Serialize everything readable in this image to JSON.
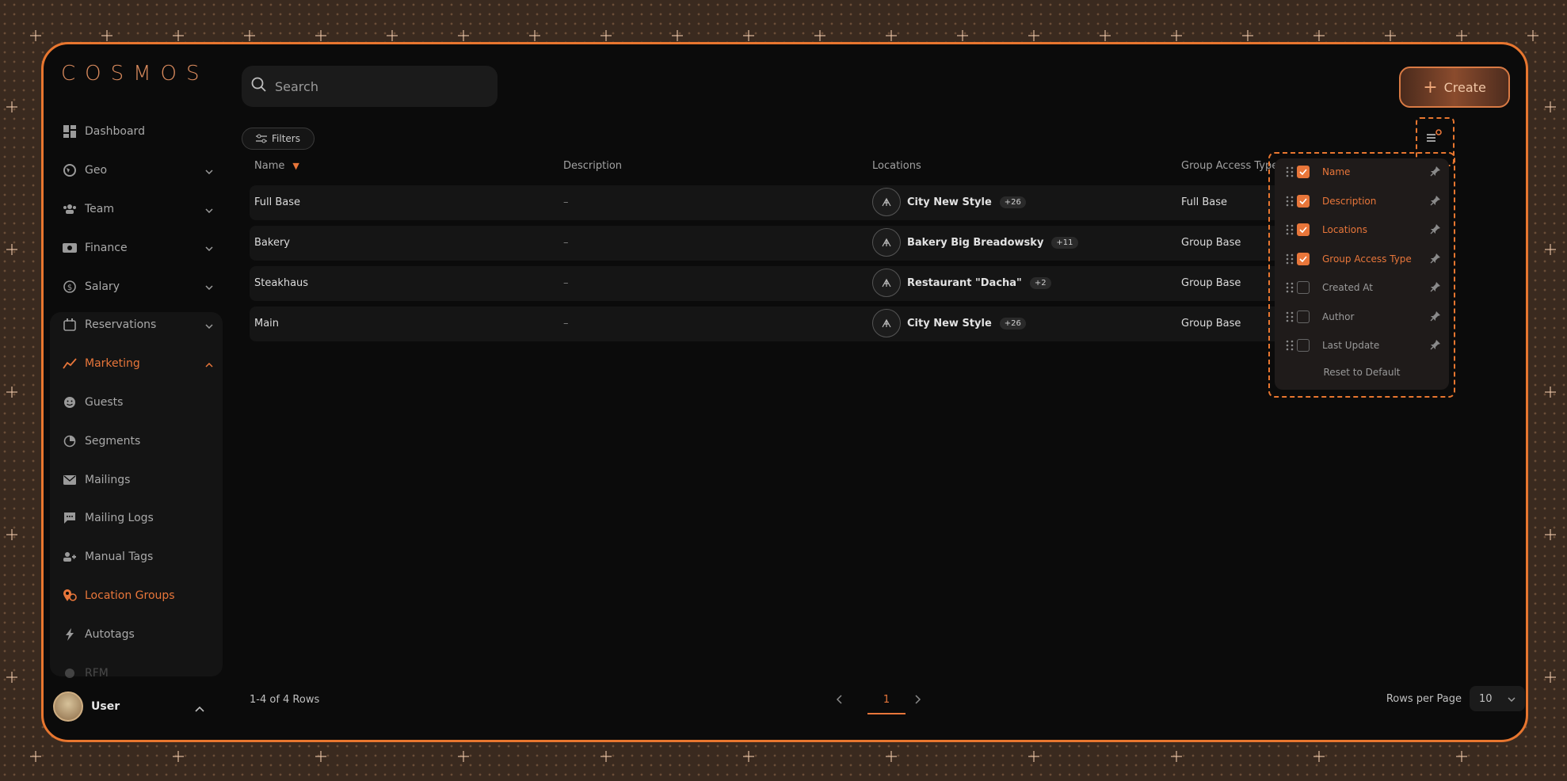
{
  "app": {
    "logo": "COSMOS"
  },
  "sidebar": {
    "items": [
      {
        "label": "Dashboard",
        "icon": "dashboard-icon"
      },
      {
        "label": "Geo",
        "icon": "globe-icon"
      },
      {
        "label": "Team",
        "icon": "team-icon"
      },
      {
        "label": "Finance",
        "icon": "finance-icon"
      },
      {
        "label": "Salary",
        "icon": "salary-icon"
      },
      {
        "label": "Reservations",
        "icon": "calendar-icon"
      },
      {
        "label": "Marketing",
        "icon": "marketing-icon"
      },
      {
        "label": "Guests",
        "icon": "guests-icon"
      },
      {
        "label": "Segments",
        "icon": "pie-icon"
      },
      {
        "label": "Mailings",
        "icon": "mail-icon"
      },
      {
        "label": "Mailing Logs",
        "icon": "chat-icon"
      },
      {
        "label": "Manual Tags",
        "icon": "tag-icon"
      },
      {
        "label": "Location Groups",
        "icon": "location-icon"
      },
      {
        "label": "Autotags",
        "icon": "bolt-icon"
      },
      {
        "label": "RFM",
        "icon": "rfm-icon"
      }
    ],
    "user": {
      "name": "User"
    }
  },
  "toolbar": {
    "search_placeholder": "Search",
    "create_label": "Create",
    "filters_label": "Filters"
  },
  "table": {
    "columns": [
      "Name",
      "Description",
      "Locations",
      "Group Access Type"
    ],
    "rows": [
      {
        "name": "Full Base",
        "description": "–",
        "location": "City New Style",
        "extra": "+26",
        "access": "Full Base"
      },
      {
        "name": "Bakery",
        "description": "–",
        "location": "Bakery Big Breadowsky",
        "extra": "+11",
        "access": "Group Base"
      },
      {
        "name": "Steakhaus",
        "description": "–",
        "location": "Restaurant \"Dacha\"",
        "extra": "+2",
        "access": "Group Base"
      },
      {
        "name": "Main",
        "description": "–",
        "location": "City New Style",
        "extra": "+26",
        "access": "Group Base"
      }
    ]
  },
  "column_settings": {
    "options": [
      {
        "label": "Name",
        "checked": true
      },
      {
        "label": "Description",
        "checked": true
      },
      {
        "label": "Locations",
        "checked": true
      },
      {
        "label": "Group Access Type",
        "checked": true
      },
      {
        "label": "Created At",
        "checked": false
      },
      {
        "label": "Author",
        "checked": false
      },
      {
        "label": "Last Update",
        "checked": false
      }
    ],
    "reset_label": "Reset to Default"
  },
  "footer": {
    "rows_info": "1-4 of 4 Rows",
    "current_page": "1",
    "rows_per_page_label": "Rows per Page",
    "rows_per_page_value": "10"
  },
  "colors": {
    "accent": "#e8763a",
    "frame": "#e8762f",
    "background": "#0b0b0b"
  }
}
